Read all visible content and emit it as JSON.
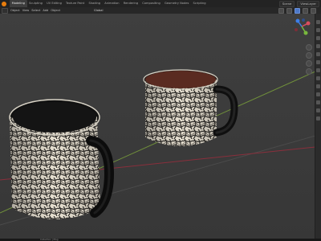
{
  "app": {
    "tabs": [
      {
        "label": "Modeling",
        "active": true
      },
      {
        "label": "Sculpting",
        "active": false
      },
      {
        "label": "UV Editing",
        "active": false
      },
      {
        "label": "Texture Paint",
        "active": false
      },
      {
        "label": "Shading",
        "active": false
      },
      {
        "label": "Animation",
        "active": false
      },
      {
        "label": "Rendering",
        "active": false
      },
      {
        "label": "Compositing",
        "active": false
      },
      {
        "label": "Geometry Nodes",
        "active": false
      },
      {
        "label": "Scripting",
        "active": false
      }
    ],
    "scene_label": "Scene",
    "layer_label": "ViewLayer"
  },
  "viewport": {
    "mode_label": "Object",
    "view_label": "View",
    "select_label": "Select",
    "add_label": "Add",
    "object_label": "Object",
    "global_label": "Global",
    "status_text": "Collection | Mug"
  },
  "icons": {
    "logo": "blender-logo-icon",
    "grid": "grid-icon",
    "hand": "hand-icon",
    "camera": "camera-icon"
  },
  "colors": {
    "accent": "#e87d0d",
    "x_axis": "#d94d5f",
    "y_axis": "#78b83d",
    "z_axis": "#3c7ee8"
  }
}
